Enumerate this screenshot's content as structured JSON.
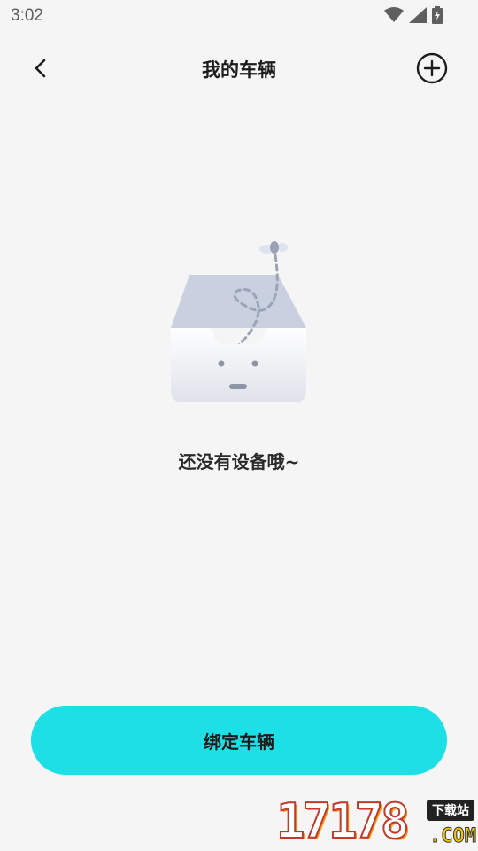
{
  "status_bar": {
    "time": "3:02",
    "icons": [
      "wifi-icon",
      "signal-icon",
      "battery-charging-icon"
    ]
  },
  "header": {
    "title": "我的车辆",
    "back_icon": "chevron-left-icon",
    "add_icon": "add-circle-icon"
  },
  "empty_state": {
    "illustration": "empty-box-icon",
    "message": "还没有设备哦~"
  },
  "bind_button": {
    "label": "绑定车辆"
  },
  "watermark": {
    "number": "17178",
    "tag": "下载站",
    "domain": ".COM"
  },
  "colors": {
    "background": "#f5f5f5",
    "accent": "#1de0e6",
    "text": "#1c1c1c"
  }
}
